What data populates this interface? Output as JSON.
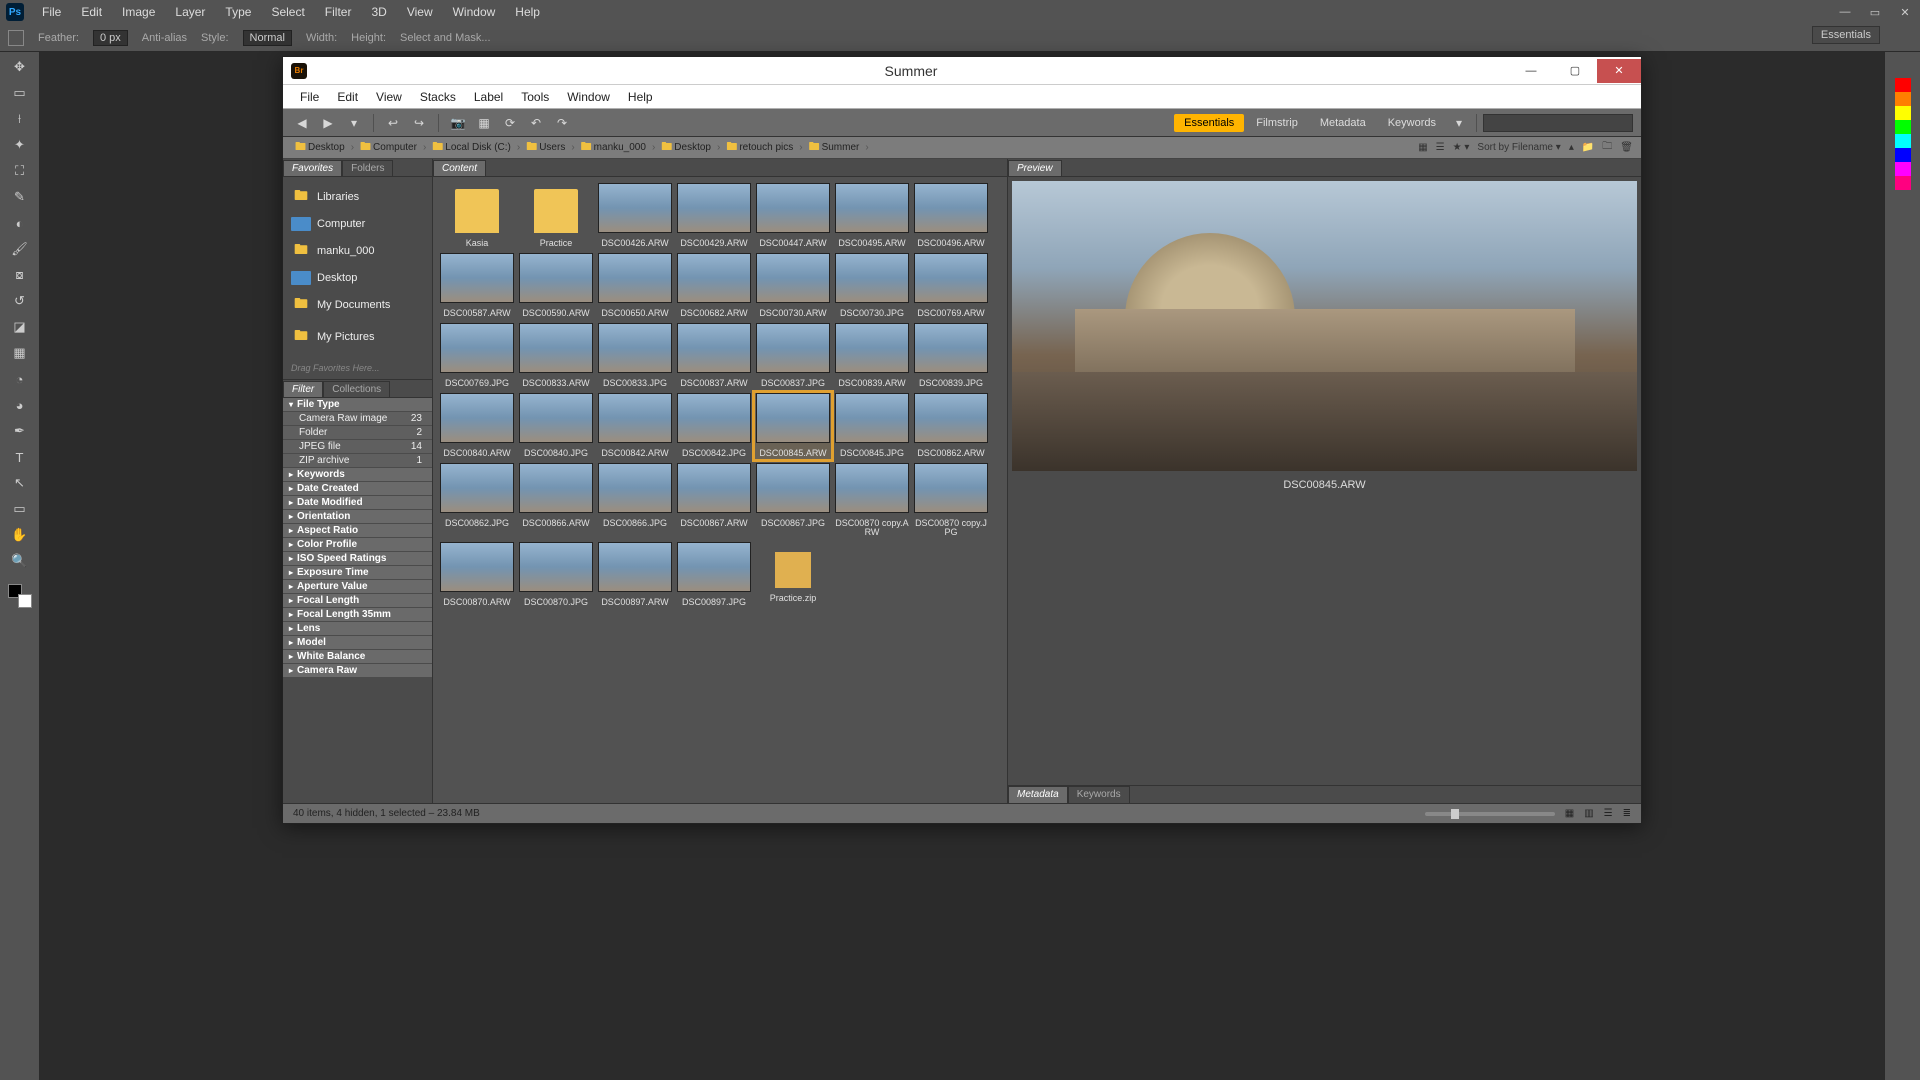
{
  "photoshop": {
    "menu": [
      "File",
      "Edit",
      "Image",
      "Layer",
      "Type",
      "Select",
      "Filter",
      "3D",
      "View",
      "Window",
      "Help"
    ],
    "options": {
      "feather_label": "Feather:",
      "feather_value": "0 px",
      "antialias": "Anti-alias",
      "style_label": "Style:",
      "style_value": "Normal",
      "width_label": "Width:",
      "height_label": "Height:",
      "selectmask": "Select and Mask..."
    },
    "essentials": "Essentials"
  },
  "bridge": {
    "title": "Summer",
    "menu": [
      "File",
      "Edit",
      "View",
      "Stacks",
      "Label",
      "Tools",
      "Window",
      "Help"
    ],
    "workspaces": {
      "active": "Essentials",
      "others": [
        "Filmstrip",
        "Metadata",
        "Keywords"
      ]
    },
    "search_placeholder": "",
    "path": [
      "Desktop",
      "Computer",
      "Local Disk (C:)",
      "Users",
      "manku_000",
      "Desktop",
      "retouch pics",
      "Summer"
    ],
    "sort_label": "Sort by Filename",
    "left_tabs": {
      "favorites": "Favorites",
      "folders": "Folders"
    },
    "favorites": [
      {
        "icon": "lib",
        "label": "Libraries"
      },
      {
        "icon": "comp",
        "label": "Computer"
      },
      {
        "icon": "user",
        "label": "manku_000"
      },
      {
        "icon": "desk",
        "label": "Desktop"
      },
      {
        "icon": "fld",
        "label": "My Documents"
      },
      {
        "icon": "fld",
        "label": "My Pictures"
      }
    ],
    "drag_hint": "Drag Favorites Here...",
    "filter_tabs": {
      "filter": "Filter",
      "collections": "Collections"
    },
    "filter_groups": [
      {
        "head": "File Type",
        "open": true,
        "rows": [
          {
            "label": "Camera Raw image",
            "count": "23"
          },
          {
            "label": "Folder",
            "count": "2"
          },
          {
            "label": "JPEG file",
            "count": "14"
          },
          {
            "label": "ZIP archive",
            "count": "1"
          }
        ]
      },
      {
        "head": "Keywords"
      },
      {
        "head": "Date Created"
      },
      {
        "head": "Date Modified"
      },
      {
        "head": "Orientation"
      },
      {
        "head": "Aspect Ratio"
      },
      {
        "head": "Color Profile"
      },
      {
        "head": "ISO Speed Ratings"
      },
      {
        "head": "Exposure Time"
      },
      {
        "head": "Aperture Value"
      },
      {
        "head": "Focal Length"
      },
      {
        "head": "Focal Length 35mm"
      },
      {
        "head": "Lens"
      },
      {
        "head": "Model"
      },
      {
        "head": "White Balance"
      },
      {
        "head": "Camera Raw"
      }
    ],
    "content_tab": "Content",
    "preview_tab": "Preview",
    "meta_tabs": {
      "metadata": "Metadata",
      "keywords": "Keywords"
    },
    "items": [
      {
        "name": "Kasia",
        "type": "folder"
      },
      {
        "name": "Practice",
        "type": "folder"
      },
      {
        "name": "DSC00426.ARW"
      },
      {
        "name": "DSC00429.ARW"
      },
      {
        "name": "DSC00447.ARW"
      },
      {
        "name": "DSC00495.ARW"
      },
      {
        "name": "DSC00496.ARW"
      },
      {
        "name": "DSC00587.ARW"
      },
      {
        "name": "DSC00590.ARW"
      },
      {
        "name": "DSC00650.ARW"
      },
      {
        "name": "DSC00682.ARW"
      },
      {
        "name": "DSC00730.ARW"
      },
      {
        "name": "DSC00730.JPG"
      },
      {
        "name": "DSC00769.ARW"
      },
      {
        "name": "DSC00769.JPG"
      },
      {
        "name": "DSC00833.ARW"
      },
      {
        "name": "DSC00833.JPG"
      },
      {
        "name": "DSC00837.ARW"
      },
      {
        "name": "DSC00837.JPG"
      },
      {
        "name": "DSC00839.ARW"
      },
      {
        "name": "DSC00839.JPG"
      },
      {
        "name": "DSC00840.ARW"
      },
      {
        "name": "DSC00840.JPG"
      },
      {
        "name": "DSC00842.ARW"
      },
      {
        "name": "DSC00842.JPG"
      },
      {
        "name": "DSC00845.ARW",
        "selected": true
      },
      {
        "name": "DSC00845.JPG"
      },
      {
        "name": "DSC00862.ARW"
      },
      {
        "name": "DSC00862.JPG"
      },
      {
        "name": "DSC00866.ARW"
      },
      {
        "name": "DSC00866.JPG"
      },
      {
        "name": "DSC00867.ARW"
      },
      {
        "name": "DSC00867.JPG"
      },
      {
        "name": "DSC00870 copy.ARW"
      },
      {
        "name": "DSC00870 copy.JPG"
      },
      {
        "name": "DSC00870.ARW"
      },
      {
        "name": "DSC00870.JPG"
      },
      {
        "name": "DSC00897.ARW"
      },
      {
        "name": "DSC00897.JPG"
      },
      {
        "name": "Practice.zip",
        "type": "zip"
      }
    ],
    "preview_name": "DSC00845.ARW",
    "status": "40 items, 4 hidden, 1 selected  –  23.84 MB"
  }
}
